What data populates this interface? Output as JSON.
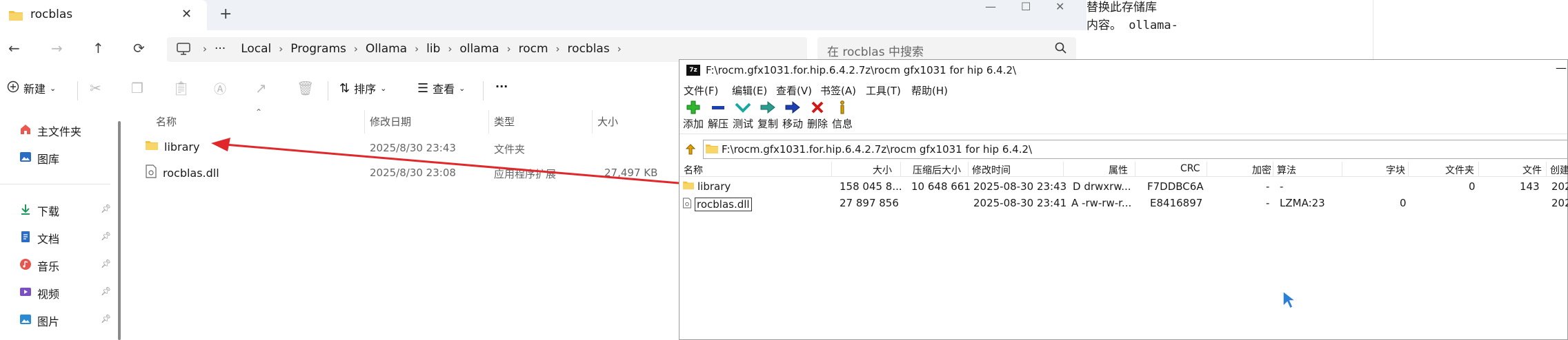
{
  "bg_doc": {
    "line1": "替换此存储库",
    "line2": "内容。 ollama-"
  },
  "explorer": {
    "tab_title": "rocblas",
    "tab_close": "✕",
    "new_tab": "+",
    "nav": {
      "back": "←",
      "forward": "→",
      "up": "↑",
      "refresh": "⟳"
    },
    "breadcrumb": [
      "···",
      "Local",
      "Programs",
      "Ollama",
      "lib",
      "ollama",
      "rocm",
      "rocblas"
    ],
    "search_placeholder": "在 rocblas 中搜索",
    "cmd": {
      "new_label": "新建",
      "sort_label": "排序",
      "view_label": "查看",
      "more": "···"
    },
    "sidebar": {
      "home": "主文件夹",
      "gallery": "图库",
      "downloads": "下载",
      "documents": "文档",
      "music": "音乐",
      "videos": "视频",
      "pictures": "图片"
    },
    "columns": {
      "name": "名称",
      "modified": "修改日期",
      "type": "类型",
      "size": "大小"
    },
    "files": [
      {
        "name": "library",
        "modified": "2025/8/30 23:43",
        "type": "文件夹",
        "size": ""
      },
      {
        "name": "rocblas.dll",
        "modified": "2025/8/30 23:08",
        "type": "应用程序扩展",
        "size": "27,497 KB"
      }
    ]
  },
  "sevenzip": {
    "logo": "7z",
    "title": "F:\\rocm.gfx1031.for.hip.6.4.2.7z\\rocm gfx1031 for hip 6.4.2\\",
    "minimize": "—",
    "menu": {
      "file": "文件(F)",
      "edit": "编辑(E)",
      "view": "查看(V)",
      "bookmarks": "书签(A)",
      "tools": "工具(T)",
      "help": "帮助(H)"
    },
    "toolbar": {
      "add": "添加",
      "extract": "解压",
      "test": "测试",
      "copy": "复制",
      "move": "移动",
      "delete": "删除",
      "info": "信息"
    },
    "path": "F:\\rocm.gfx1031.for.hip.6.4.2.7z\\rocm gfx1031 for hip 6.4.2\\",
    "columns": {
      "name": "名称",
      "size": "大小",
      "packed": "压缩后大小",
      "modified": "修改时间",
      "attr": "属性",
      "crc": "CRC",
      "encrypted": "加密",
      "method": "算法",
      "block": "字块",
      "folders": "文件夹",
      "files": "文件",
      "created": "创建"
    },
    "rows": [
      {
        "name": "library",
        "size": "158 045 8...",
        "packed": "10 648 661",
        "modified": "2025-08-30 23:43",
        "attr": "D drwxrw...",
        "crc": "F7DDBC6A",
        "encrypted": "-",
        "method": "-",
        "block": "",
        "folders": "0",
        "files": "143",
        "created": "202"
      },
      {
        "name": "rocblas.dll",
        "size": "27 897 856",
        "packed": "",
        "modified": "2025-08-30 23:41",
        "attr": "A -rw-rw-r...",
        "crc": "E8416897",
        "encrypted": "-",
        "method": "LZMA:23",
        "block": "0",
        "folders": "",
        "files": "",
        "created": "202"
      }
    ]
  },
  "colors": {
    "accent": "#0067c0",
    "arrow": "#e0282a",
    "folder": "#f5c342"
  }
}
